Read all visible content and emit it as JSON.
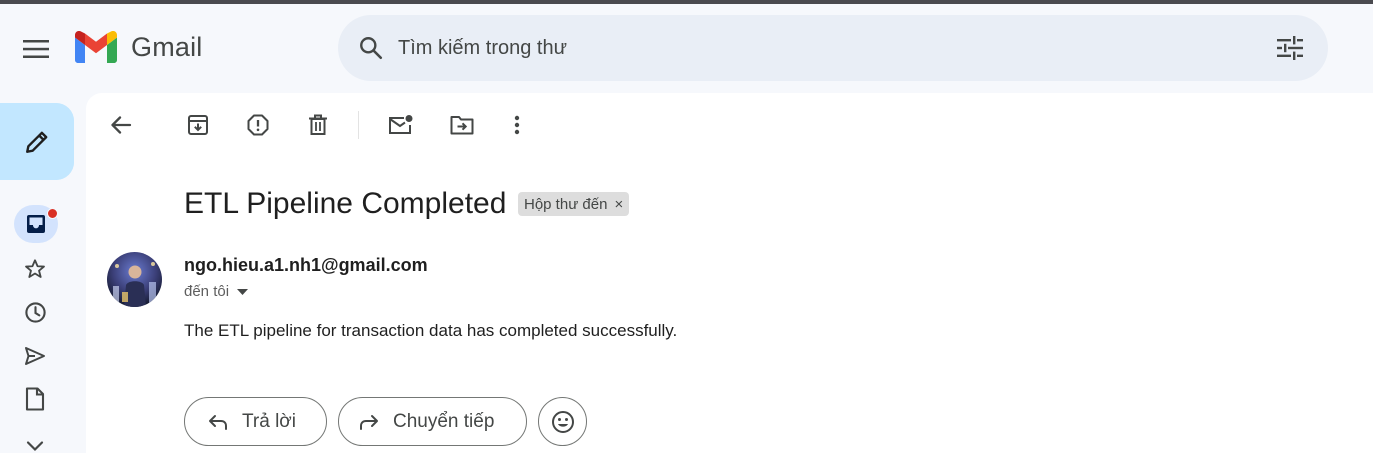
{
  "header": {
    "app_name": "Gmail",
    "search_placeholder": "Tìm kiếm trong thư"
  },
  "rail": {
    "items": [
      {
        "icon": "inbox-icon",
        "active": true,
        "badge": true
      },
      {
        "icon": "star-icon"
      },
      {
        "icon": "clock-icon"
      },
      {
        "icon": "send-icon"
      },
      {
        "icon": "draft-icon"
      },
      {
        "icon": "chevron-down-icon"
      }
    ]
  },
  "toolbar": {
    "icons": [
      "back-arrow-icon",
      "archive-icon",
      "report-spam-icon",
      "delete-icon",
      "mark-unread-icon",
      "move-to-icon",
      "more-vert-icon"
    ]
  },
  "email": {
    "subject": "ETL Pipeline Completed",
    "label": "Hộp thư đến",
    "label_close": "×",
    "sender": "ngo.hieu.a1.nh1@gmail.com",
    "to": "đến tôi",
    "body": "The ETL pipeline for transaction data has completed successfully."
  },
  "actions": {
    "reply": "Trả lời",
    "forward": "Chuyển tiếp"
  },
  "colors": {
    "background": "#f6f8fc",
    "search_bg": "#e9eef6",
    "compose_bg": "#c2e7ff",
    "active_rail": "#d3e3fd",
    "badge": "#d93025",
    "label_chip": "#dddddd"
  }
}
